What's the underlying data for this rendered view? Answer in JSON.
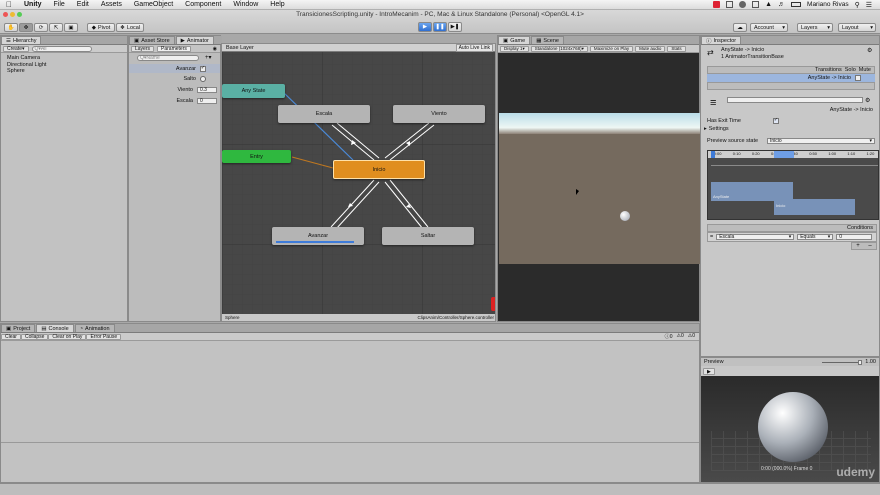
{
  "menubar": {
    "app": "Unity",
    "items": [
      "File",
      "Edit",
      "Assets",
      "GameObject",
      "Component",
      "Window",
      "Help"
    ],
    "user": "Mariano Rivas"
  },
  "window": {
    "title": "TransicionesScripting.unity - IntroMecanim - PC, Mac & Linux Standalone (Personal) <OpenGL 4.1>"
  },
  "toolbar": {
    "pivot": "Pivot",
    "local": "Local",
    "account": "Account",
    "layers": "Layers",
    "layout": "Layout"
  },
  "hierarchy": {
    "tab": "Hierarchy",
    "create": "Create",
    "search_placeholder": "Q▾All",
    "items": [
      "Main Camera",
      "Directional Light",
      "Sphere"
    ]
  },
  "animator": {
    "tabs": [
      "Asset Store",
      "Animator"
    ],
    "sub_tabs": [
      "Layers",
      "Parameters"
    ],
    "search_placeholder": "Q▾Name",
    "params": [
      {
        "name": "Avanzar",
        "kind": "bool",
        "value": "✓"
      },
      {
        "name": "Salto",
        "kind": "trigger",
        "value": ""
      },
      {
        "name": "Viento",
        "kind": "float",
        "value": "0.3"
      },
      {
        "name": "Escala",
        "kind": "int",
        "value": "0"
      }
    ],
    "layer": "Base Layer",
    "auto_live_link": "Auto Live Link",
    "footer_left": "Sphere",
    "footer_right": "ClipsAnim/Controller/Sphere.controller",
    "nodes": {
      "any_state": "Any State",
      "entry": "Entry",
      "escala": "Escala",
      "viento": "Viento",
      "inicio": "Inicio",
      "avanzar": "Avanzar",
      "saltar": "Saltar"
    }
  },
  "game": {
    "tabs": [
      "Game",
      "Scene"
    ],
    "display": "Display 1",
    "resolution": "Standalone (1024x768)",
    "maximize": "Maximize on Play",
    "mute": "Mute audio",
    "stats": "Stats"
  },
  "inspector": {
    "tab": "Inspector",
    "title": "AnyState -> Inicio",
    "subtitle": "1 AnimatorTransitionBase",
    "transitions_header": "Transitions",
    "solo": "Solo",
    "mute": "Mute",
    "transition_item": "AnyState -> Inicio",
    "transition_name": "AnyState -> Inicio",
    "has_exit_time": "Has Exit Time",
    "settings": "Settings",
    "preview_source_label": "Preview source state",
    "preview_source_value": "Inicio",
    "timeline_ticks": [
      "0:00",
      "0:10",
      "0:20",
      "0:30",
      "0:40",
      "0:50",
      "1:00",
      "1:10",
      "1:20"
    ],
    "clip_a": "AnyState",
    "clip_b": "Inicio",
    "conditions": "Conditions",
    "condition": {
      "param": "Escala",
      "op": "Equals",
      "value": "0"
    }
  },
  "console": {
    "tabs": [
      "Project",
      "Console",
      "Animation"
    ],
    "buttons": [
      "Clear",
      "Collapse",
      "Clear on Play",
      "Error Pause"
    ],
    "counts": [
      "0",
      "0",
      "0"
    ]
  },
  "preview": {
    "label": "Preview",
    "speed": "1.00",
    "status": "0:00 (000.0%) Frame 0"
  },
  "watermark": "udemy",
  "colors": {
    "any_state": "#5ab0a4",
    "entry": "#2fb83f",
    "inicio": "#e08e1f",
    "node": "#b4b4b4",
    "graph_bg": "#4a4a4a",
    "selection": "#3e7bd8"
  }
}
